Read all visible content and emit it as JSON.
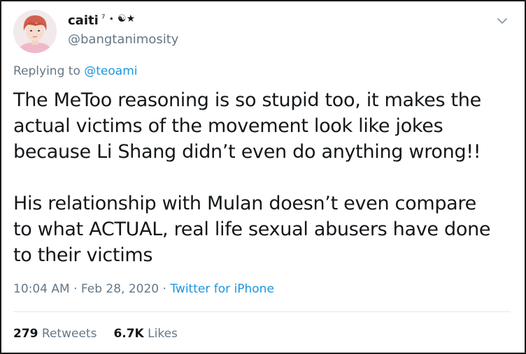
{
  "author": {
    "name": "caiti",
    "badge": "⁷ ⋆ ☯︎★",
    "handle": "@bangtanimosity"
  },
  "reply": {
    "prefix": "Replying to",
    "handle": "@teoami"
  },
  "tweet": {
    "lines": [
      "The MeToo reasoning is so stupid too, it makes the",
      "actual victims of the movement look like jokes",
      "because Li Shang didn’t even do anything wrong!!",
      "His relationship with Mulan doesn’t even compare",
      "to what ACTUAL, real life sexual abusers have done",
      "to their victims"
    ]
  },
  "meta": {
    "time": "10:04 AM",
    "date": "Feb 28, 2020",
    "source": "Twitter for iPhone"
  },
  "stats": {
    "retweets_count": "279",
    "retweets_label": "Retweets",
    "likes_count": "6.7K",
    "likes_label": "Likes"
  },
  "colors": {
    "link": "#1b95e0",
    "muted": "#657786",
    "text": "#14171a",
    "avatar_hair": "#d2604f"
  },
  "icons": {
    "menu": "chevron-down-icon"
  }
}
